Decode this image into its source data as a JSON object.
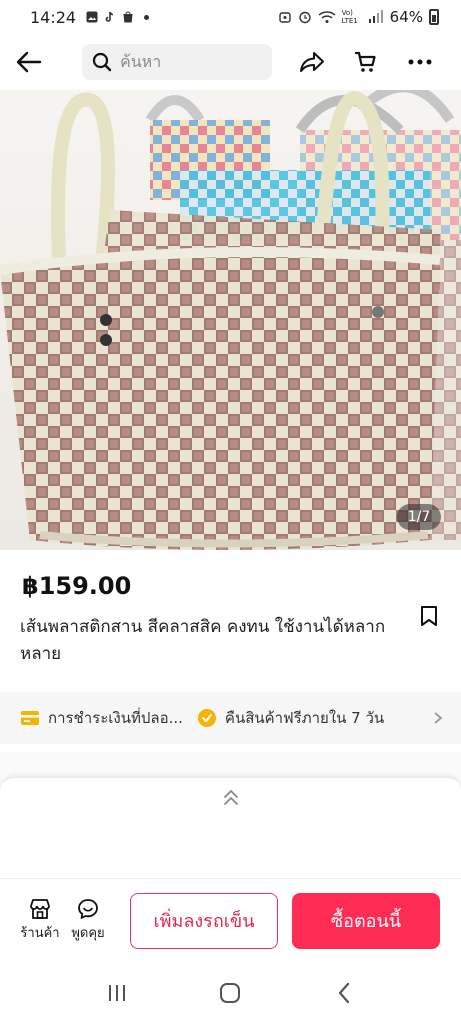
{
  "status_bar": {
    "time": "14:24",
    "network": "Vo) LTE1",
    "battery": "64%"
  },
  "search": {
    "placeholder": "ค้นหา"
  },
  "product": {
    "image_counter": "1/7",
    "price": "฿159.00",
    "title": "เส้นพลาสติกสาน สีคลาสสิค คงทน ใช้งานได้หลากหลาย"
  },
  "benefits": [
    {
      "label": "การชำระเงินที่ปลอ...",
      "icon": "card-icon"
    },
    {
      "label": "คืนสินค้าฟรีภายใน 7 วัน",
      "icon": "return-badge-icon"
    }
  ],
  "action_bar": {
    "shop_label": "ร้านค้า",
    "chat_label": "พูดคุย",
    "add_to_cart_label": "เพิ่มลงรถเข็น",
    "buy_now_label": "ซื้อตอนนี้"
  },
  "colors": {
    "brand": "#fe2c55",
    "benefit_icon": "#f5b400"
  }
}
